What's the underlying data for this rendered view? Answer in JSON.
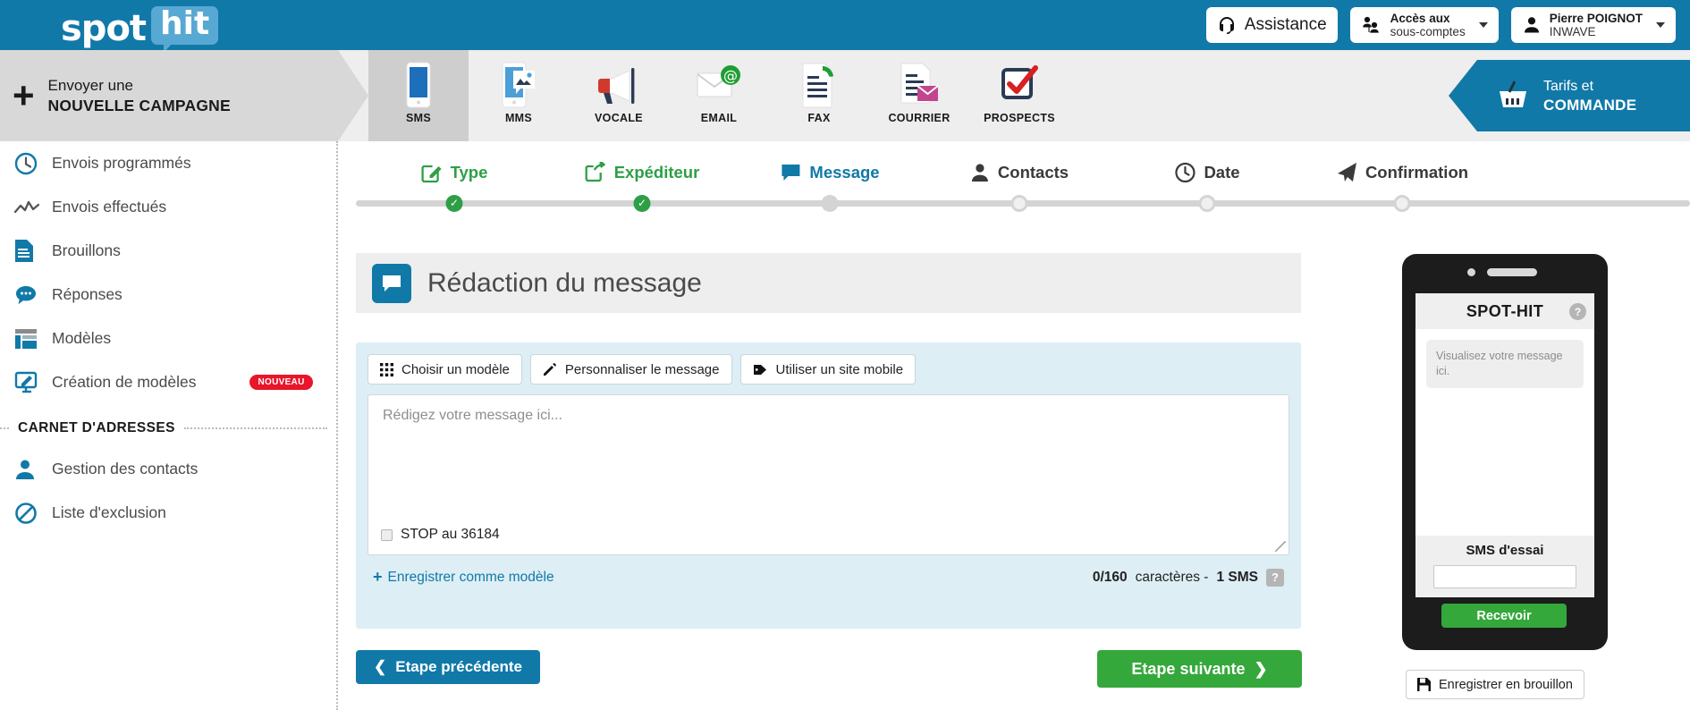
{
  "header": {
    "logo_main": "spot",
    "logo_accent": "hit",
    "assistance_label": "Assistance",
    "subaccounts_line1": "Accès aux",
    "subaccounts_line2": "sous-comptes",
    "user_name": "Pierre POIGNOT",
    "user_org": "INWAVE",
    "brand_blue": "#1179a8"
  },
  "sidebar": {
    "new_campaign_line1": "Envoyer une",
    "new_campaign_line2": "NOUVELLE CAMPAGNE",
    "items": [
      {
        "label": "Envois programmés",
        "icon": "clock-icon"
      },
      {
        "label": "Envois effectués",
        "icon": "chart-line-icon"
      },
      {
        "label": "Brouillons",
        "icon": "document-icon"
      },
      {
        "label": "Réponses",
        "icon": "speech-bubble-icon"
      },
      {
        "label": "Modèles",
        "icon": "layout-icon"
      },
      {
        "label": "Création de modèles",
        "icon": "design-screen-icon",
        "badge": "NOUVEAU"
      }
    ],
    "section_title": "CARNET D'ADRESSES",
    "address_items": [
      {
        "label": "Gestion des contacts",
        "icon": "person-icon"
      },
      {
        "label": "Liste d'exclusion",
        "icon": "ban-icon"
      }
    ]
  },
  "nav": {
    "tabs": [
      {
        "label": "SMS",
        "icon": "phone-sms-icon",
        "active": true
      },
      {
        "label": "MMS",
        "icon": "phone-mms-icon",
        "active": false
      },
      {
        "label": "VOCALE",
        "icon": "megaphone-icon",
        "active": false
      },
      {
        "label": "EMAIL",
        "icon": "email-at-icon",
        "active": false
      },
      {
        "label": "FAX",
        "icon": "fax-icon",
        "active": false
      },
      {
        "label": "COURRIER",
        "icon": "letter-icon",
        "active": false
      },
      {
        "label": "PROSPECTS",
        "icon": "checkbox-check-icon",
        "active": false
      }
    ],
    "order_line1": "Tarifs et",
    "order_line2": "COMMANDE"
  },
  "stepper": {
    "steps": [
      {
        "label": "Type",
        "state": "done",
        "icon": "edit-square-icon"
      },
      {
        "label": "Expéditeur",
        "state": "done",
        "icon": "share-icon"
      },
      {
        "label": "Message",
        "state": "current",
        "icon": "speech-bubble-icon"
      },
      {
        "label": "Contacts",
        "state": "todo",
        "icon": "person-icon"
      },
      {
        "label": "Date",
        "state": "todo",
        "icon": "clock-icon"
      },
      {
        "label": "Confirmation",
        "state": "todo",
        "icon": "paper-plane-icon"
      }
    ],
    "done_color": "#2e9f46",
    "current_color": "#1179a8"
  },
  "main": {
    "panel_title": "Rédaction du message",
    "tools": [
      {
        "label": "Choisir un modèle",
        "icon": "grid-icon"
      },
      {
        "label": "Personnaliser le message",
        "icon": "pencil-icon"
      },
      {
        "label": "Utiliser un site mobile",
        "icon": "tag-icon"
      }
    ],
    "textarea_placeholder": "Rédigez votre message ici...",
    "textarea_value": "",
    "stop_label": "STOP au 36184",
    "stop_checked": false,
    "save_template_label": "Enregistrer comme modèle",
    "save_template_plus": "+",
    "counter_count": "0/160",
    "counter_unit": "caractères -",
    "counter_sms": "1 SMS",
    "help_glyph": "?",
    "prev_label": "Etape précédente",
    "next_label": "Etape suivante"
  },
  "preview": {
    "screen_title": "SPOT-HIT",
    "help_glyph": "?",
    "bubble_text": "Visualisez votre message ici.",
    "test_sms_label": "SMS d'essai",
    "test_input_value": "",
    "receive_label": "Recevoir",
    "draft_label": "Enregistrer en brouillon",
    "green": "#34a83a"
  }
}
